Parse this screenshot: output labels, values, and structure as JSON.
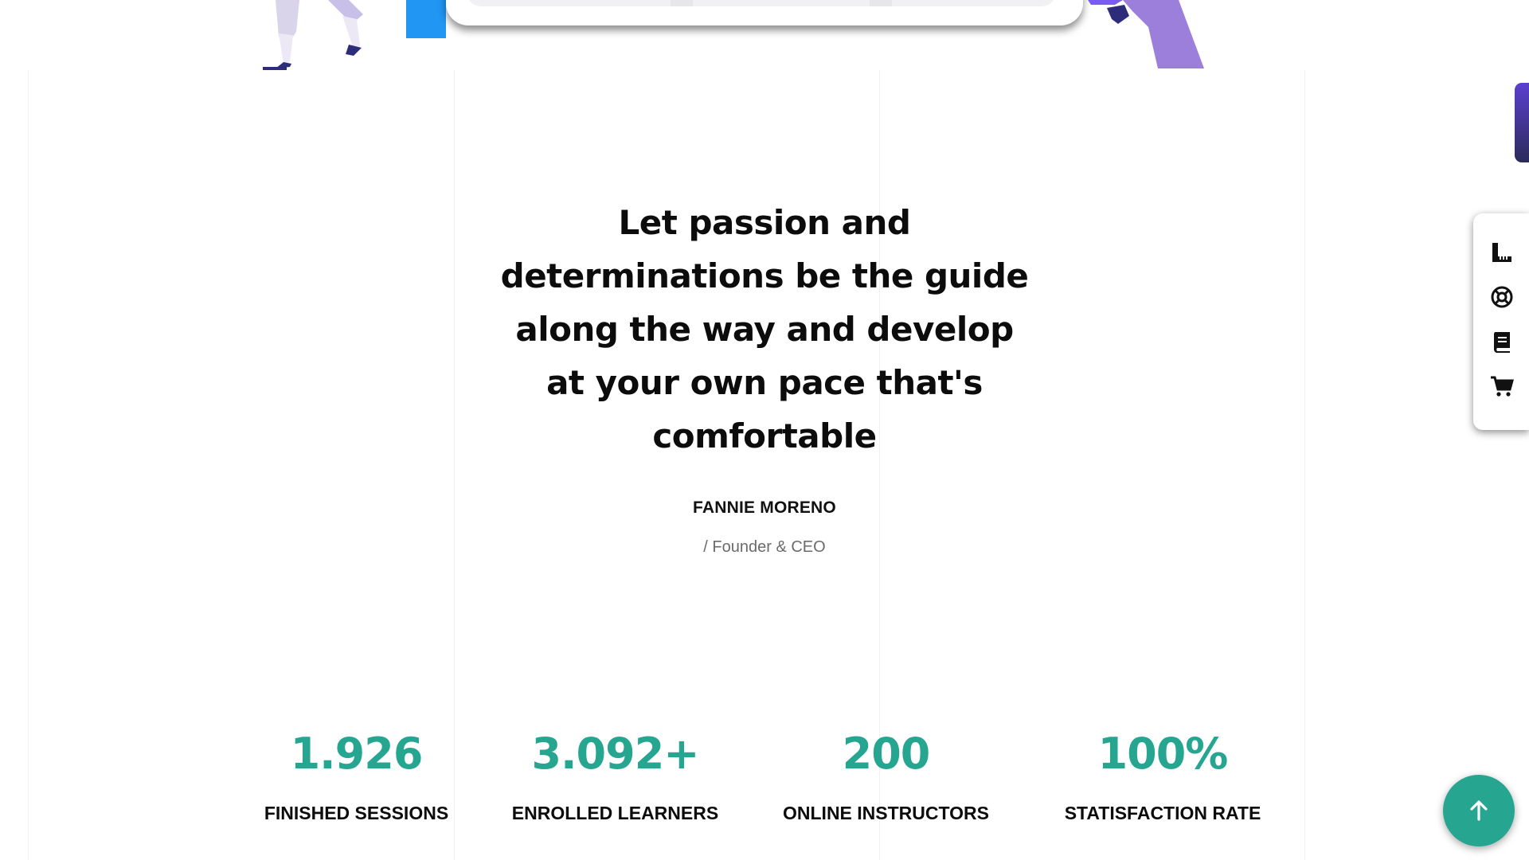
{
  "testimonial": {
    "quote_lines": [
      "Let passion and",
      "determinations be the guide",
      "along the way and develop",
      "at your own pace that's",
      "comfortable"
    ],
    "author_name": "FANNIE MORENO",
    "author_role": "/ Founder & CEO"
  },
  "stats": [
    {
      "value": "1.926",
      "label": "FINISHED SESSIONS"
    },
    {
      "value": "3.092+",
      "label": "ENROLLED LEARNERS"
    },
    {
      "value": "200",
      "label": "ONLINE INSTRUCTORS"
    },
    {
      "value": "100%",
      "label": "STATISFACTION RATE"
    }
  ],
  "side_toolbar": {
    "icons": [
      "ruler-icon",
      "support-lifebuoy-icon",
      "book-icon",
      "cart-icon"
    ]
  },
  "scroll_top": {
    "icon": "arrow-up-icon"
  },
  "colors": {
    "accent": "#26a690",
    "text": "#0c0c0c",
    "muted": "#6b6b6b",
    "purple": "#7a5cf5"
  }
}
